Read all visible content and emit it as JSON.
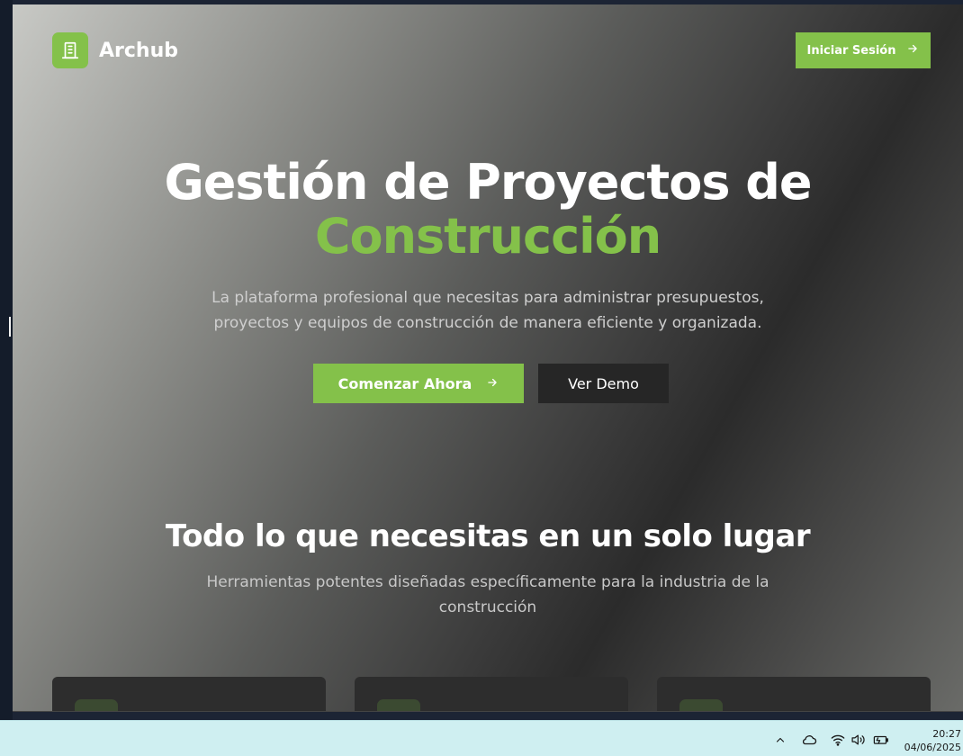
{
  "app": {
    "brand": "Archub",
    "login_label": "Iniciar Sesión"
  },
  "hero": {
    "title_line1": "Gestión de Proyectos de",
    "title_line2": "Construcción",
    "subtitle": "La plataforma profesional que necesitas para administrar presupuestos, proyectos y equipos de construcción de manera eficiente y organizada.",
    "primary_cta": "Comenzar Ahora",
    "secondary_cta": "Ver Demo"
  },
  "features": {
    "title": "Todo lo que necesitas en un solo lugar",
    "subtitle": "Herramientas potentes diseñadas específicamente para la industria de la construcción"
  },
  "taskbar": {
    "time": "20:27",
    "date": "04/06/2025",
    "icons": [
      "chevron-up-icon",
      "cloud-icon",
      "wifi-icon",
      "speaker-icon",
      "battery-icon"
    ]
  },
  "colors": {
    "accent": "#84c14a",
    "dark_button": "#262626",
    "taskbar": "#cfeff1"
  }
}
